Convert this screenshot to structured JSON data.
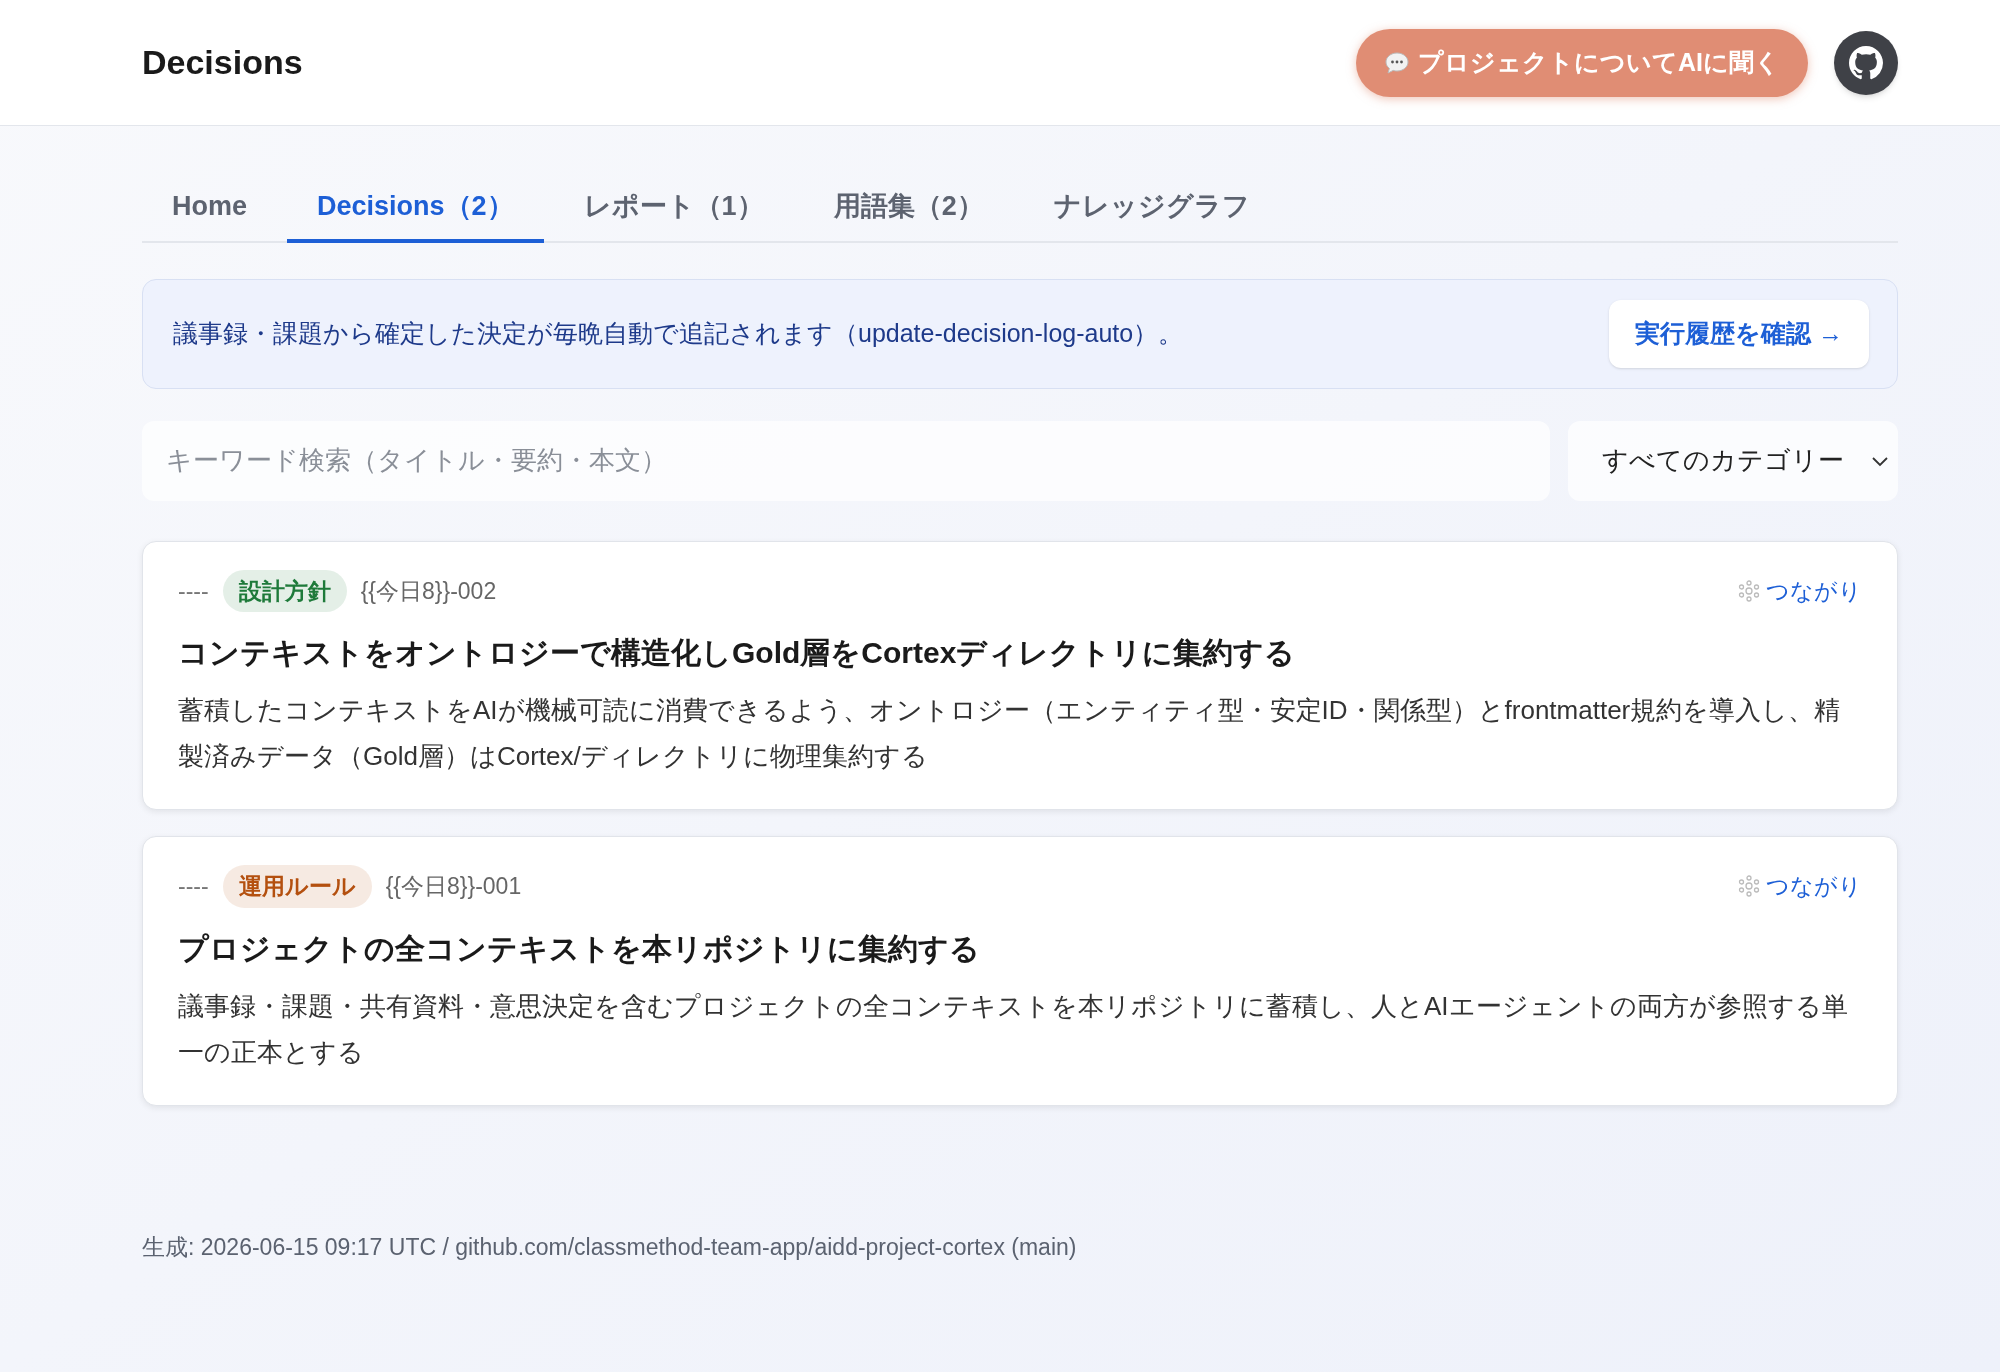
{
  "header": {
    "title": "Decisions",
    "ask_button": "プロジェクトについてAIに聞く"
  },
  "tabs": [
    {
      "label": "Home",
      "selected": false
    },
    {
      "label": "Decisions（2）",
      "selected": true
    },
    {
      "label": "レポート（1）",
      "selected": false
    },
    {
      "label": "用語集（2）",
      "selected": false
    },
    {
      "label": "ナレッジグラフ",
      "selected": false
    }
  ],
  "banner": {
    "text": "議事録・課題から確定した決定が毎晩自動で追記されます（update-decision-log-auto）。",
    "button": "実行履歴を確認 →"
  },
  "search": {
    "placeholder": "キーワード検索（タイトル・要約・本文）"
  },
  "category_select": {
    "value": "すべてのカテゴリー"
  },
  "decisions": [
    {
      "date": "----",
      "category": "設計方針",
      "color": "#1e7a3a",
      "id": "{{今日8}}-002",
      "link": "つながり",
      "title": "コンテキストをオントロジーで構造化しGold層をCortexディレクトリに集約する",
      "summary": "蓄積したコンテキストをAIが機械可読に消費できるよう、オントロジー（エンティティ型・安定ID・関係型）とfrontmatter規約を導入し、精製済みデータ（Gold層）はCortex/ディレクトリに物理集約する"
    },
    {
      "date": "----",
      "category": "運用ルール",
      "color": "#b4500f",
      "id": "{{今日8}}-001",
      "link": "つながり",
      "title": "プロジェクトの全コンテキストを本リポジトリに集約する",
      "summary": "議事録・課題・共有資料・意思決定を含むプロジェクトの全コンテキストを本リポジトリに蓄積し、人とAIエージェントの両方が参照する単一の正本とする"
    }
  ],
  "footer": "生成: 2026-06-15 09:17 UTC / github.com/classmethod-team-app/aidd-project-cortex (main)"
}
